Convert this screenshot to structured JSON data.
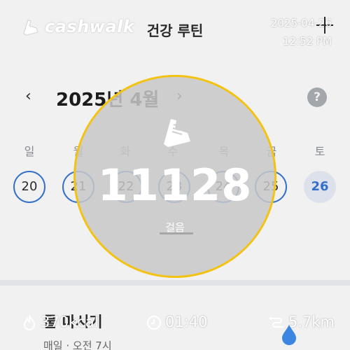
{
  "header": {
    "title": "건강 루틴"
  },
  "calendar": {
    "month_label": "2025년 4월",
    "prev_icon": "chevron-left-icon",
    "next_icon": "chevron-right-icon",
    "help_label": "?",
    "weekdays": [
      "일",
      "월",
      "화",
      "수",
      "목",
      "금",
      "토"
    ],
    "dates": [
      "20",
      "21",
      "22",
      "23",
      "24",
      "25",
      "26"
    ],
    "selected_date": "26"
  },
  "routine": {
    "title": "물 마시기",
    "subtitle": "매일 · 오전 7시"
  },
  "overlay": {
    "brand": "cashwalk",
    "date": "2025-04-26",
    "time": "12:52 PM",
    "steps": "11128",
    "steps_label": "걸음",
    "calories": "370kcal",
    "duration": "01:40",
    "distance": "5.7km"
  },
  "colors": {
    "accent_blue": "#2d6fd2",
    "ring_yellow": "#f3c314",
    "today_bg": "#e9eef9",
    "drop_blue": "#3a86e0"
  }
}
